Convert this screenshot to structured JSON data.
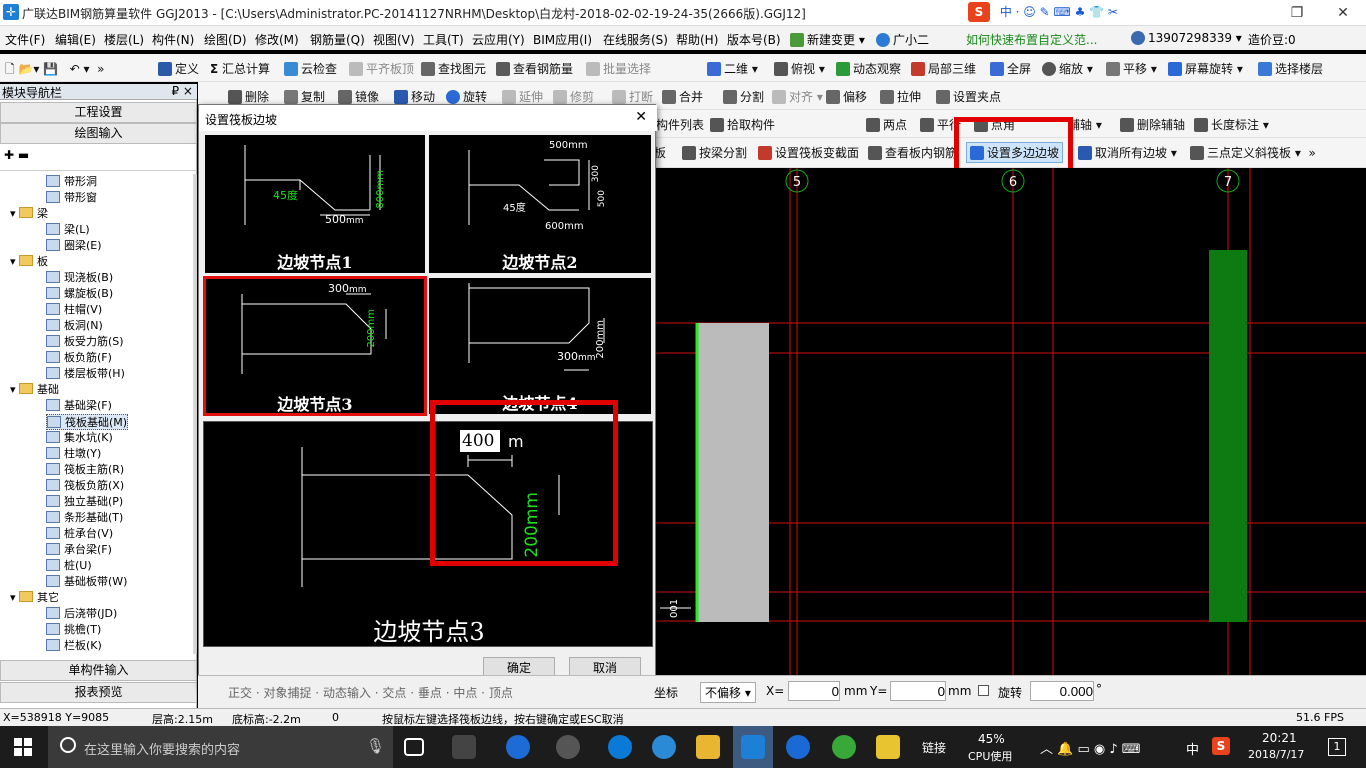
{
  "titlebar": {
    "title": "广联达BIM钢筋算量软件 GGJ2013 - [C:\\Users\\Administrator.PC-20141127NRHM\\Desktop\\白龙村-2018-02-02-19-24-35(2666版).GGJ12]",
    "minimize": "—",
    "restore": "❐",
    "close": "✕"
  },
  "menubar": {
    "items": [
      "文件(F)",
      "编辑(E)",
      "楼层(L)",
      "构件(N)",
      "绘图(D)",
      "修改(M)",
      "钢筋量(Q)",
      "视图(V)",
      "工具(T)",
      "云应用(Y)",
      "BIM应用(I)",
      "在线服务(S)",
      "帮助(H)",
      "版本号(B)",
      "新建变更",
      "广小二"
    ],
    "hint": "如何快速布置自定义范...",
    "phone": "13907298339",
    "beans": "造价豆:0"
  },
  "toolbar1": {
    "items": [
      "定义",
      "汇总计算",
      "云检查",
      "平齐板顶",
      "查找图元",
      "查看钢筋量",
      "批量选择",
      "二维",
      "俯视",
      "动态观察",
      "局部三维",
      "全屏",
      "缩放",
      "平移",
      "屏幕旋转",
      "选择楼层"
    ]
  },
  "toolbar2": {
    "items": [
      "删除",
      "复制",
      "镜像",
      "移动",
      "旋转",
      "延伸",
      "修剪",
      "打断",
      "合并",
      "分割",
      "对齐",
      "偏移",
      "拉伸",
      "设置夹点"
    ]
  },
  "toolbar3": {
    "items": [
      "构件列表",
      "拾取构件",
      "两点",
      "平行",
      "点角",
      "辅轴",
      "删除辅轴",
      "长度标注"
    ]
  },
  "toolbar4": {
    "items": [
      "板",
      "按梁分割",
      "设置筏板变截面",
      "查看板内钢筋",
      "设置多边边坡",
      "取消所有边坡",
      "三点定义斜筏板"
    ]
  },
  "nav": {
    "header": "模块导航栏",
    "pin": "₽ ×",
    "btn_project": "工程设置",
    "btn_draw": "绘图输入",
    "btn_single": "单构件输入",
    "btn_report": "报表预览",
    "tree": [
      {
        "label": "带形洞",
        "lvl": 2
      },
      {
        "label": "带形窗",
        "lvl": 2
      },
      {
        "label": "梁",
        "lvl": 1
      },
      {
        "label": "梁(L)",
        "lvl": 2
      },
      {
        "label": "圈梁(E)",
        "lvl": 2
      },
      {
        "label": "板",
        "lvl": 1
      },
      {
        "label": "现浇板(B)",
        "lvl": 2
      },
      {
        "label": "螺旋板(B)",
        "lvl": 2
      },
      {
        "label": "柱帽(V)",
        "lvl": 2
      },
      {
        "label": "板洞(N)",
        "lvl": 2
      },
      {
        "label": "板受力筋(S)",
        "lvl": 2
      },
      {
        "label": "板负筋(F)",
        "lvl": 2
      },
      {
        "label": "楼层板带(H)",
        "lvl": 2
      },
      {
        "label": "基础",
        "lvl": 1
      },
      {
        "label": "基础梁(F)",
        "lvl": 2
      },
      {
        "label": "筏板基础(M)",
        "lvl": 2
      },
      {
        "label": "集水坑(K)",
        "lvl": 2
      },
      {
        "label": "柱墩(Y)",
        "lvl": 2
      },
      {
        "label": "筏板主筋(R)",
        "lvl": 2
      },
      {
        "label": "筏板负筋(X)",
        "lvl": 2
      },
      {
        "label": "独立基础(P)",
        "lvl": 2
      },
      {
        "label": "条形基础(T)",
        "lvl": 2
      },
      {
        "label": "桩承台(V)",
        "lvl": 2
      },
      {
        "label": "承台梁(F)",
        "lvl": 2
      },
      {
        "label": "桩(U)",
        "lvl": 2
      },
      {
        "label": "基础板带(W)",
        "lvl": 2
      },
      {
        "label": "其它",
        "lvl": 1
      },
      {
        "label": "后浇带(JD)",
        "lvl": 2
      },
      {
        "label": "挑檐(T)",
        "lvl": 2
      },
      {
        "label": "栏板(K)",
        "lvl": 2
      }
    ]
  },
  "dialog": {
    "title": "设置筏板边坡",
    "close": "✕",
    "opt1": {
      "label": "边坡节点1",
      "angle": "45度",
      "w": "500",
      "h": "800",
      "unit": "mm"
    },
    "opt2": {
      "label": "边坡节点2",
      "w1": "500",
      "w2": "600",
      "h1": "300",
      "h2": "500",
      "angle": "45度",
      "unit": "mm"
    },
    "opt3": {
      "label": "边坡节点3",
      "w": "300",
      "h": "200",
      "unit": "mm"
    },
    "opt4": {
      "label": "边坡节点4",
      "w": "300",
      "h": "200",
      "unit": "mm"
    },
    "preview": {
      "label": "边坡节点3",
      "input": "400",
      "unit_m": "m",
      "h": "200",
      "h_unit": "mm"
    },
    "ok": "确定",
    "cancel": "取消"
  },
  "canvas": {
    "axes": [
      "5",
      "6",
      "7"
    ],
    "dim": "001"
  },
  "bottom": {
    "items": [
      "正交",
      "对象捕捉",
      "动态输入",
      "交点",
      "垂点",
      "中点",
      "顶点",
      "坐标"
    ],
    "offset": "不偏移",
    "x_label": "X=",
    "x_val": "0",
    "y_label": "Y=",
    "y_val": "0",
    "mm": "mm",
    "rotate": "旋转",
    "rot_val": "0.000",
    "deg": "°"
  },
  "status": {
    "coord": "X=538918  Y=9085",
    "floor": "层高:2.15m",
    "base": "底标高:-2.2m",
    "zero": "0",
    "msg": "按鼠标左键选择筏板边线，按右键确定或ESC取消",
    "fps": "51.6 FPS"
  },
  "taskbar": {
    "search": "在这里输入你要搜索的内容",
    "link": "链接",
    "cpu_pct": "45%",
    "cpu": "CPU使用",
    "ime": "中",
    "time": "20:21",
    "date": "2018/7/17",
    "notif": "1"
  },
  "colors": {
    "accent_red": "#e00000",
    "canvas": "#000000",
    "grid_red": "#d01010",
    "slab_gray": "#bbbbbb",
    "slab_green": "#0e7a12"
  }
}
